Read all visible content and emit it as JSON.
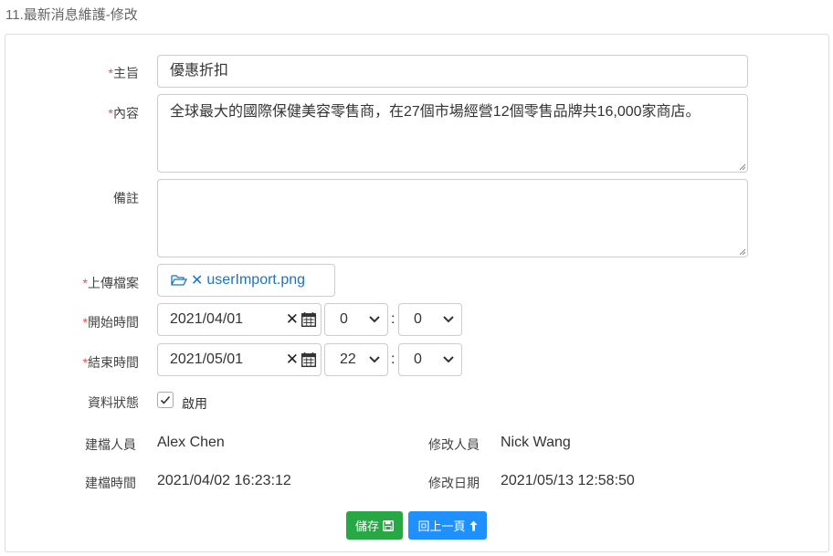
{
  "page": {
    "title": "11.最新消息維護-修改"
  },
  "form": {
    "subject": {
      "required_mark": "*",
      "label": "主旨",
      "value": "優惠折扣"
    },
    "content": {
      "required_mark": "*",
      "label": "內容",
      "value": "全球最大的國際保健美容零售商，在27個市場經營12個零售品牌共16,000家商店。"
    },
    "remarks": {
      "label": "備註",
      "value": ""
    },
    "upload": {
      "required_mark": "*",
      "label": "上傳檔案",
      "filename": "userImport.png"
    },
    "start": {
      "required_mark": "*",
      "label": "開始時間",
      "date": "2021/04/01",
      "hour": "0",
      "minute": "0",
      "colon": ":"
    },
    "end": {
      "required_mark": "*",
      "label": "結束時間",
      "date": "2021/05/01",
      "hour": "22",
      "minute": "0",
      "colon": ":"
    },
    "status": {
      "label": "資料狀態",
      "checkbox_label": "啟用",
      "checked": true
    }
  },
  "meta": {
    "creator_label": "建檔人員",
    "creator": "Alex Chen",
    "modifier_label": "修改人員",
    "modifier": "Nick Wang",
    "created_label": "建檔時間",
    "created": "2021/04/02 16:23:12",
    "modified_label": "修改日期",
    "modified": "2021/05/13 12:58:50"
  },
  "actions": {
    "save_label": "儲存",
    "back_label": "回上一頁"
  },
  "colors": {
    "save": "#28a745",
    "back": "#1e90ff",
    "required": "#d9534f",
    "link": "#1a73c9"
  }
}
